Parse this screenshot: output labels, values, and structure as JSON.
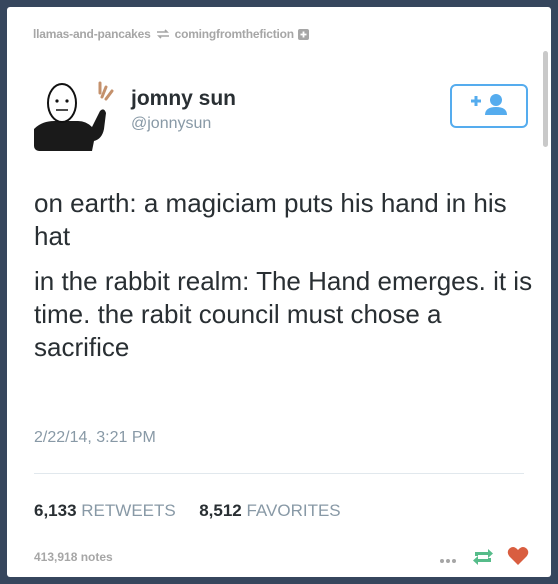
{
  "reblog": {
    "from_user": "llamas-and-pancakes",
    "to_user": "comingfromthefiction"
  },
  "tweet": {
    "name": "jomny sun",
    "handle": "@jonnysun",
    "text_paragraphs": [
      "on earth: a magiciam puts his hand in his hat",
      "in the rabbit realm: The Hand emerges. it is time. the rabit council must chose a sacrifice"
    ],
    "timestamp": "2/22/14, 3:21 PM",
    "retweets_count": "6,133",
    "retweets_label": "RETWEETS",
    "favorites_count": "8,512",
    "favorites_label": "FAVORITES"
  },
  "footer": {
    "notes": "413,918 notes"
  },
  "colors": {
    "background": "#36465d",
    "twitter_blue": "#55acee",
    "reblog_green": "#56bc8a",
    "like_red": "#d95e40"
  },
  "icons": [
    "reblog-icon",
    "plus-square-icon",
    "follow-user-icon",
    "more-dots-icon",
    "reblog-icon",
    "heart-icon"
  ]
}
